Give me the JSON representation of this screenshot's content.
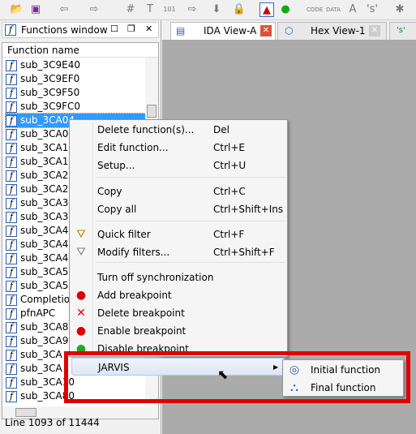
{
  "toolbar": {
    "icons": [
      "open-folder-icon",
      "save-icon",
      "back-arrow-icon",
      "forward-arrow-icon",
      "binoculars-hash-icon",
      "binoculars-text-icon",
      "binoculars-binary-icon",
      "binoculars-next-icon",
      "jump-down-icon",
      "lock-icon",
      "warning-icon",
      "green-circle-icon",
      "code-icon",
      "data-icon",
      "ascii-icon",
      "string-icon",
      "asterisk-icon"
    ]
  },
  "functions_window": {
    "title": "Functions window",
    "column_header": "Function name",
    "rows": [
      "sub_3C9E40",
      "sub_3C9EF0",
      "sub_3C9F50",
      "sub_3C9FC0",
      "sub_3CA04",
      "sub_3CA0",
      "sub_3CA1",
      "sub_3CA1",
      "sub_3CA28",
      "sub_3CA2",
      "sub_3CA34",
      "sub_3CA3",
      "sub_3CA47",
      "sub_3CA4",
      "sub_3CA4",
      "sub_3CA50",
      "sub_3CA57",
      "Completio",
      "pfnAPC",
      "sub_3CA8",
      "sub_3CA9",
      "sub_3CA",
      "sub_3CA",
      "sub_3CA10",
      "sub_3CA80"
    ],
    "selected_index": 4,
    "status": "Line 1093 of 11444"
  },
  "tabs": [
    {
      "label": "IDA View-A",
      "active": true
    },
    {
      "label": "Hex View-1",
      "active": false
    },
    {
      "label": "'s'",
      "active": false
    }
  ],
  "context_menu": {
    "items": [
      {
        "label": "Delete function(s)...",
        "shortcut": "Del"
      },
      {
        "label": "Edit function...",
        "shortcut": "Ctrl+E"
      },
      {
        "label": "Setup...",
        "shortcut": "Ctrl+U"
      },
      {
        "label": "Copy",
        "shortcut": "Ctrl+C"
      },
      {
        "label": "Copy all",
        "shortcut": "Ctrl+Shift+Ins"
      },
      {
        "label": "Quick filter",
        "shortcut": "Ctrl+F"
      },
      {
        "label": "Modify filters...",
        "shortcut": "Ctrl+Shift+F"
      },
      {
        "label": "Turn off synchronization",
        "shortcut": ""
      },
      {
        "label": "Add breakpoint",
        "shortcut": ""
      },
      {
        "label": "Delete breakpoint",
        "shortcut": ""
      },
      {
        "label": "Enable breakpoint",
        "shortcut": ""
      },
      {
        "label": "Disable breakpoint",
        "shortcut": ""
      },
      {
        "label": "JARVIS",
        "shortcut": ""
      }
    ]
  },
  "submenu": {
    "items": [
      "Initial function",
      "Final function"
    ]
  },
  "highlight_color": "#e00000"
}
